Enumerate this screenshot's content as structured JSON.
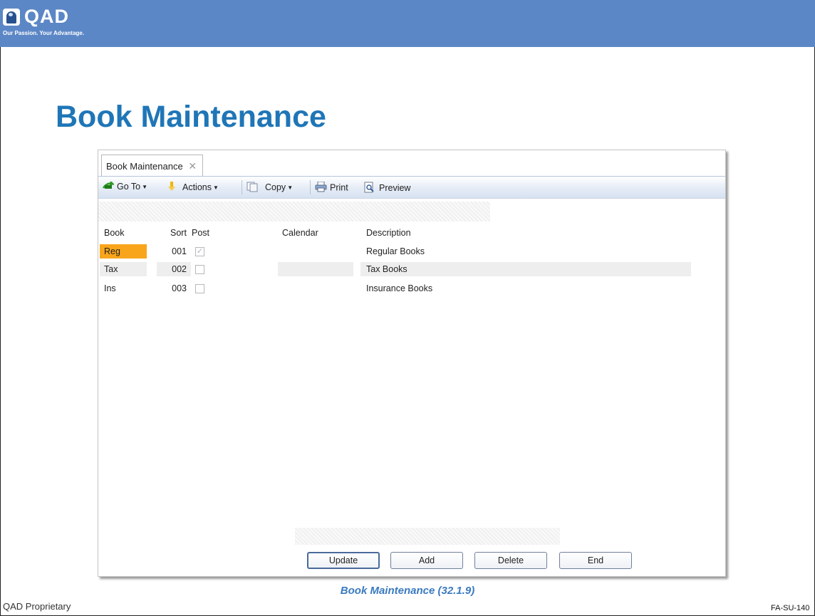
{
  "header": {
    "logo_text": "QAD",
    "tagline": "Our Passion. Your Advantage."
  },
  "slide": {
    "title": "Book Maintenance",
    "caption": "Book Maintenance (32.1.9)",
    "footer_left": "QAD Proprietary",
    "footer_right": "FA-SU-140"
  },
  "window": {
    "tab_label": "Book Maintenance",
    "toolbar": {
      "goto": "Go To",
      "actions": "Actions",
      "copy": "Copy",
      "print": "Print",
      "preview": "Preview"
    },
    "columns": {
      "book": "Book",
      "sort": "Sort",
      "post": "Post",
      "calendar": "Calendar",
      "description": "Description"
    },
    "rows": [
      {
        "book": "Reg",
        "sort": "001",
        "post": true,
        "calendar": "",
        "description": "Regular Books",
        "selected": true
      },
      {
        "book": "Tax",
        "sort": "002",
        "post": false,
        "calendar": "",
        "description": "Tax Books",
        "selected": false
      },
      {
        "book": "Ins",
        "sort": "003",
        "post": false,
        "calendar": "",
        "description": "Insurance Books",
        "selected": false
      }
    ],
    "buttons": {
      "update": "Update",
      "add": "Add",
      "delete": "Delete",
      "end": "End"
    }
  },
  "colors": {
    "header_bar": "#5c87c6",
    "title": "#1f76b7",
    "selected_cell": "#f9a51b",
    "caption": "#3a7abf"
  }
}
